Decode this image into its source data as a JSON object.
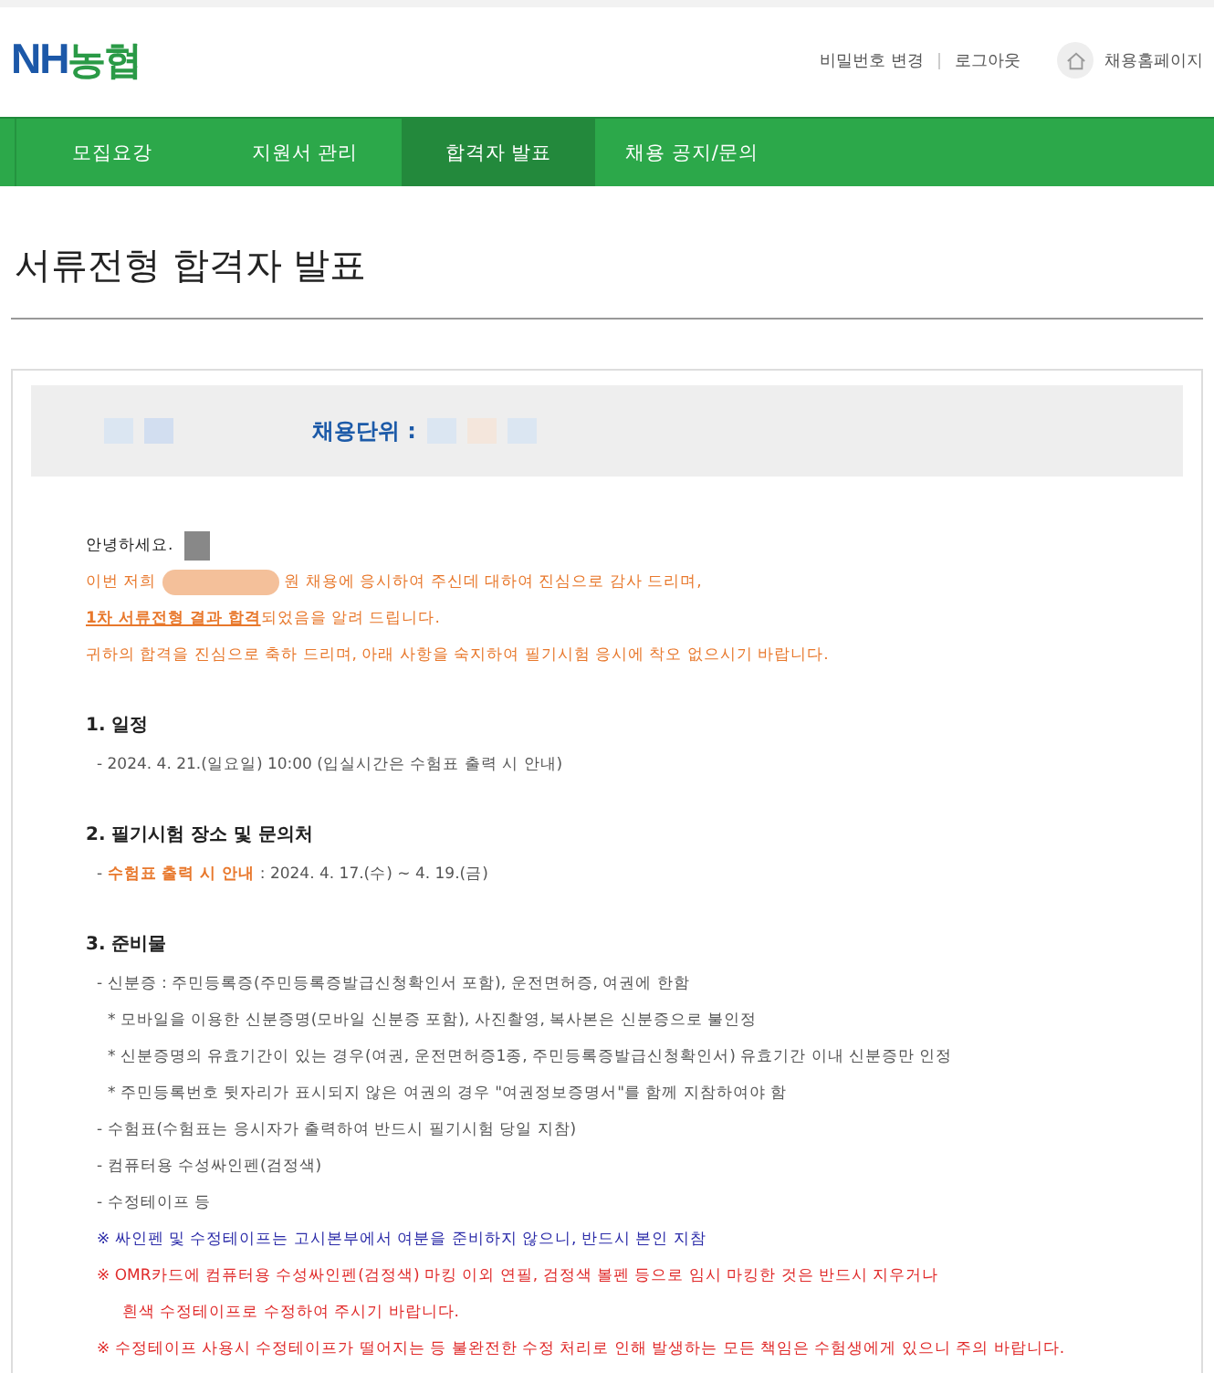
{
  "header": {
    "logo_latin": "NH",
    "logo_korean": "농협",
    "links": [
      "비밀번호 변경",
      "로그아웃"
    ],
    "home_link": "채용홈페이지"
  },
  "nav": [
    {
      "label": "모집요강",
      "selected": false
    },
    {
      "label": "지원서 관리",
      "selected": false
    },
    {
      "label": "합격자 발표",
      "selected": true
    },
    {
      "label": "채용 공지/문의",
      "selected": false
    }
  ],
  "page_title": "서류전형 합격자 발표",
  "notice": {
    "unit_label": "채용단위 :",
    "greeting": "안녕하세요.",
    "intro_start": "이번 저희",
    "intro_end": "원 채용에 응시하여 주신데 대하여 진심으로 감사 드리며,",
    "result_emphasis": "1차 서류전형 결과 합격",
    "result_rest": "되었음을 알려 드립니다.",
    "congrats": "귀하의 합격을 진심으로 축하 드리며, 아래 사항을 숙지하여 필기시험 응시에 착오 없으시기 바랍니다.",
    "sections": [
      {
        "title": "1. 일정",
        "lines": [
          {
            "kind": "dash",
            "text": "- 2024. 4. 21.(일요일) 10:00 (입실시간은 수험표 출력 시 안내)"
          }
        ]
      },
      {
        "title": "2. 필기시험 장소 및 문의처",
        "lines": [
          {
            "kind": "labeled",
            "prefix": "-",
            "label": "수험표 출력 시 안내",
            "text": ": 2024. 4. 17.(수) ~ 4. 19.(금)"
          }
        ]
      },
      {
        "title": "3. 준비물",
        "lines": [
          {
            "kind": "dash",
            "text": "- 신분증 : 주민등록증(주민등록증발급신청확인서 포함), 운전면허증, 여권에 한함"
          },
          {
            "kind": "bullet",
            "text": "* 모바일을 이용한 신분증명(모바일 신분증 포함), 사진촬영, 복사본은 신분증으로 불인정"
          },
          {
            "kind": "bullet",
            "text": "* 신분증명의 유효기간이 있는 경우(여권, 운전면허증1종, 주민등록증발급신청확인서) 유효기간 이내 신분증만 인정"
          },
          {
            "kind": "bullet",
            "text": "* 주민등록번호 뒷자리가 표시되지 않은 여권의 경우 \"여권정보증명서\"를 함께 지참하여야 함"
          },
          {
            "kind": "dash",
            "text": "- 수험표(수험표는 응시자가 출력하여 반드시 필기시험 당일 지참)"
          },
          {
            "kind": "dash",
            "text": "- 컴퓨터용 수성싸인펜(검정색)"
          },
          {
            "kind": "dash",
            "text": "- 수정테이프 등"
          },
          {
            "kind": "note",
            "color": "#2a2aa8",
            "text": "※ 싸인펜 및 수정테이프는 고시본부에서 여분을 준비하지 않으니, 반드시 본인 지참"
          },
          {
            "kind": "note",
            "color": "#e02a2a",
            "text": "※ OMR카드에 컴퓨터용 수성싸인펜(검정색) 마킹 이외 연필, 검정색 볼펜 등으로 임시 마킹한 것은 반드시 지우거나"
          },
          {
            "kind": "continuation",
            "color": "#e02a2a",
            "text": "흰색 수정테이프로 수정하여 주시기 바랍니다."
          },
          {
            "kind": "note",
            "color": "#e02a2a",
            "text": "※ 수정테이프 사용시 수정테이프가 떨어지는 등 불완전한 수정 처리로 인해 발생하는 모든 책임은 수험생에게 있으니 주의 바랍니다."
          }
        ]
      }
    ]
  }
}
